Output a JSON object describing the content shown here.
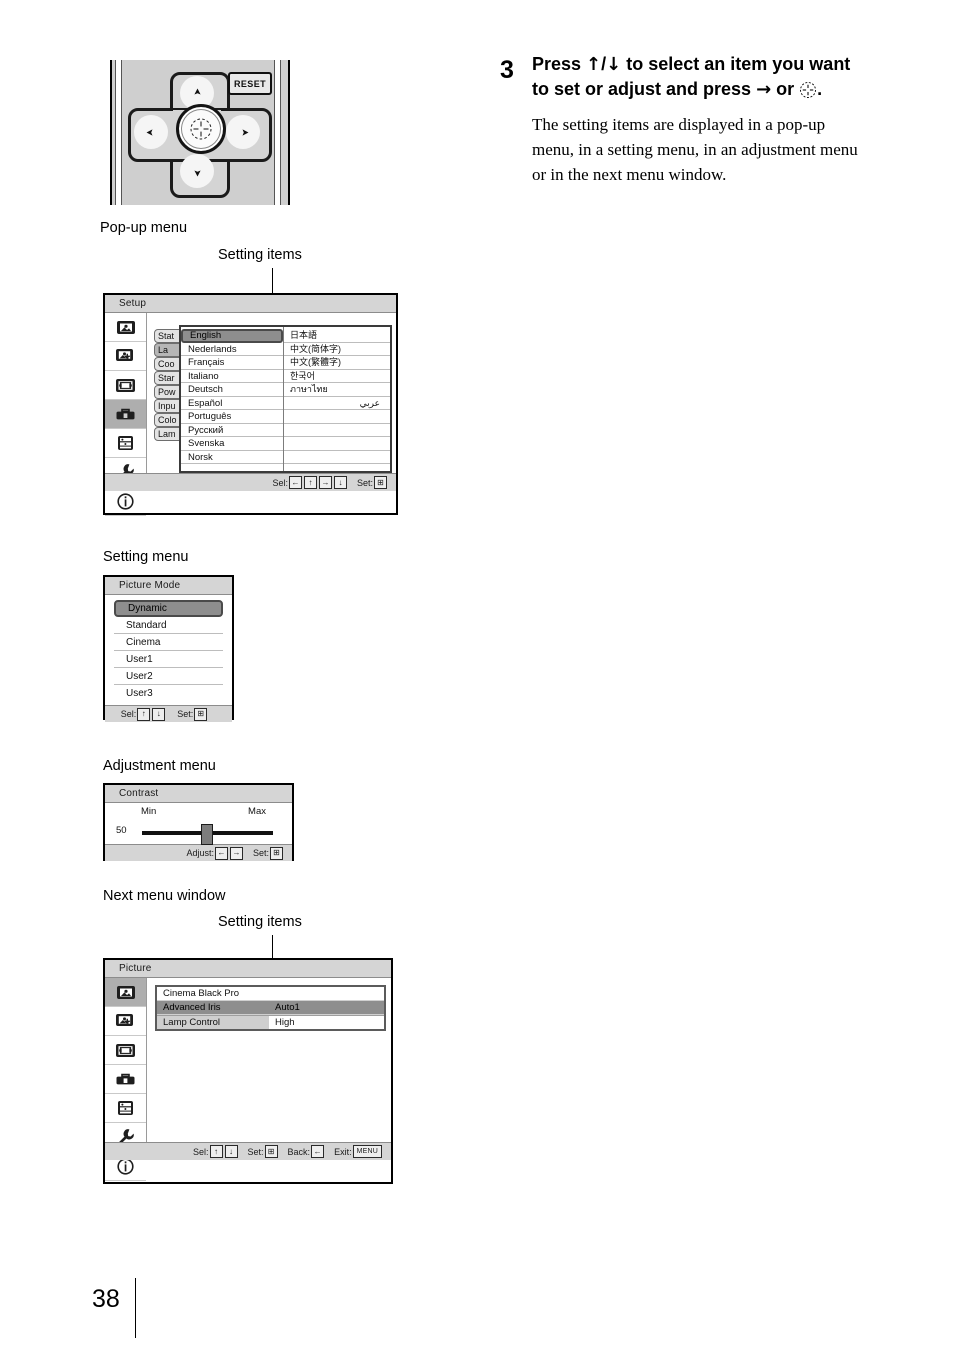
{
  "remote": {
    "reset_label": "RESET",
    "up_icon": "arrow-up-icon",
    "down_icon": "arrow-down-icon",
    "left_icon": "arrow-left-icon",
    "right_icon": "arrow-right-icon",
    "enter_icon": "enter-button-icon"
  },
  "captions": {
    "popup_menu": "Pop-up menu",
    "setting_items_1": "Setting items",
    "setting_menu": "Setting menu",
    "adjustment_menu": "Adjustment menu",
    "next_menu_window": "Next menu window",
    "setting_items_2": "Setting items"
  },
  "instruction": {
    "step_number": "3",
    "heading_part1": "Press ",
    "heading_up": "↑",
    "heading_slash": "/",
    "heading_down": "↓",
    "heading_part2": " to select an item you want to set or adjust and press ",
    "heading_right": "→",
    "heading_or": " or ",
    "heading_end": ".",
    "body": "The setting items are displayed in a pop-up menu, in a setting menu, in an adjustment menu or in the next menu window."
  },
  "popup_menu": {
    "title": "Setup",
    "sidebar_icons": [
      "picture-icon",
      "picture-adjust-icon",
      "screen-icon",
      "setup-toolbox-icon",
      "function-list-icon",
      "installation-wrench-icon",
      "information-icon"
    ],
    "selected_sidebar_index": 3,
    "hidden_items": [
      "Stat",
      "La",
      "Coo",
      "Star",
      "Pow",
      "Inpu",
      "Colo",
      "Lam"
    ],
    "selected_hidden_index": 1,
    "languages_left": [
      "English",
      "Nederlands",
      "Français",
      "Italiano",
      "Deutsch",
      "Español",
      "Português",
      "Русский",
      "Svenska",
      "Norsk"
    ],
    "selected_language": "English",
    "languages_right": [
      "日本語",
      "中文(简体字)",
      "中文(繁體字)",
      "한국어",
      "ภาษาไทย",
      "عربي"
    ],
    "footer": {
      "sel_label": "Sel:",
      "sel_keys": [
        "←",
        "↑",
        "→",
        "↓"
      ],
      "set_label": "Set:",
      "set_key": "⊞"
    }
  },
  "setting_menu": {
    "title": "Picture Mode",
    "options": [
      "Dynamic",
      "Standard",
      "Cinema",
      "User1",
      "User2",
      "User3"
    ],
    "selected_option": "Dynamic",
    "footer": {
      "sel_label": "Sel:",
      "sel_keys": [
        "↑",
        "↓"
      ],
      "set_label": "Set:",
      "set_key": "⊞"
    }
  },
  "adjustment_menu": {
    "title": "Contrast",
    "min_label": "Min",
    "max_label": "Max",
    "value": "50",
    "footer": {
      "adjust_label": "Adjust:",
      "adjust_keys": [
        "←",
        "→"
      ],
      "set_label": "Set:",
      "set_key": "⊞"
    }
  },
  "next_menu_window": {
    "title": "Picture",
    "sidebar_icons": [
      "picture-icon",
      "picture-adjust-icon",
      "screen-icon",
      "setup-toolbox-icon",
      "function-list-icon",
      "installation-wrench-icon",
      "information-icon"
    ],
    "selected_sidebar_index": 0,
    "rows": [
      {
        "label": "Cinema Black Pro",
        "value": ""
      },
      {
        "label": "Advanced Iris",
        "value": "Auto1"
      },
      {
        "label": "Lamp Control",
        "value": "High"
      }
    ],
    "selected_row_index": 1,
    "footer": {
      "sel_label": "Sel:",
      "sel_keys": [
        "↑",
        "↓"
      ],
      "set_label": "Set:",
      "set_key": "⊞",
      "back_label": "Back:",
      "back_key": "←",
      "exit_label": "Exit:",
      "exit_key": "MENU"
    }
  },
  "page": {
    "number": "38"
  }
}
